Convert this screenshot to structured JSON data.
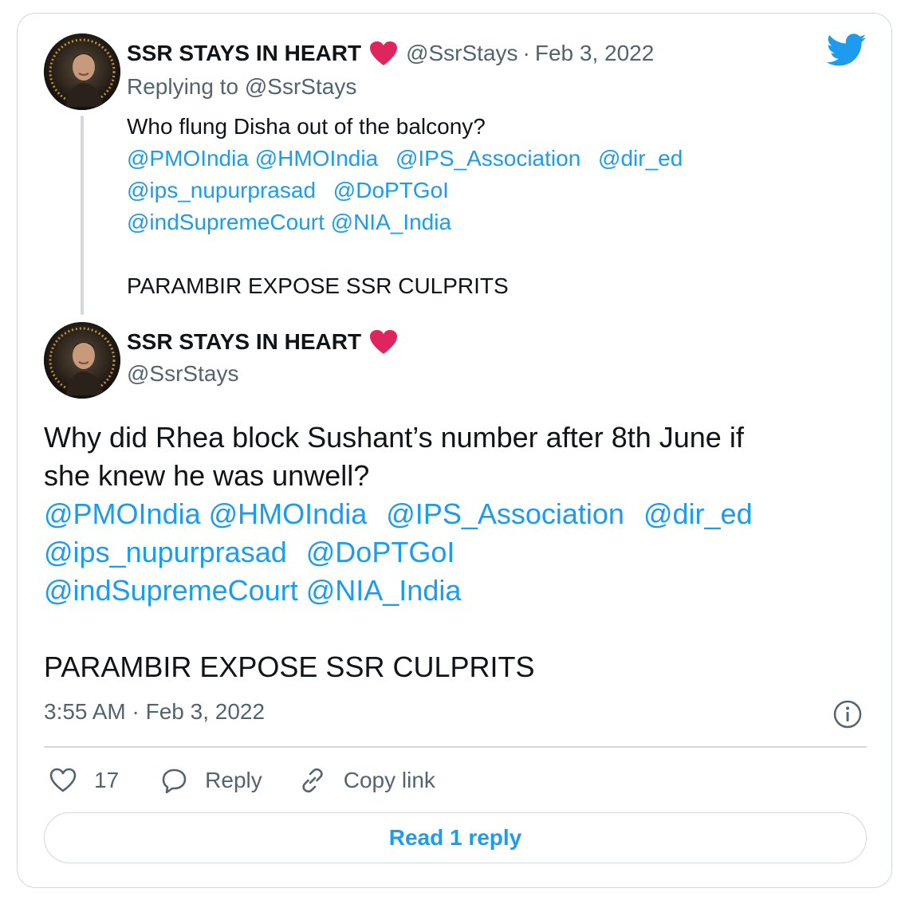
{
  "parent_tweet": {
    "display_name": "SSR STAYS IN HEART",
    "handle": "@SsrStays",
    "separator": "·",
    "date": "Feb 3, 2022",
    "replying_prefix": "Replying to",
    "replying_to": "@SsrStays",
    "text_line1": "Who flung Disha out of the balcony?",
    "mentions": {
      "pmo": "@PMOIndia",
      "hmo": "@HMOIndia",
      "ips": "@IPS_Association",
      "dir": "@dir_ed",
      "nupur": "@ips_nupurprasad",
      "dopt": "@DoPTGoI",
      "court": "@indSupremeCourt",
      "nia": "@NIA_India"
    },
    "text_last": "PARAMBIR EXPOSE SSR CULPRITS"
  },
  "main_tweet": {
    "display_name": "SSR STAYS IN HEART",
    "handle": "@SsrStays",
    "text_line1": "Why did Rhea block Sushant’s number after 8th June if",
    "text_line2": "she knew he was unwell?",
    "mentions": {
      "pmo": "@PMOIndia",
      "hmo": "@HMOIndia",
      "ips": "@IPS_Association",
      "dir": "@dir_ed",
      "nupur": "@ips_nupurprasad",
      "dopt": "@DoPTGoI",
      "court": "@indSupremeCourt",
      "nia": "@NIA_India"
    },
    "text_last": "PARAMBIR EXPOSE SSR CULPRITS",
    "time": "3:55 AM",
    "separator": "·",
    "date": "Feb 3, 2022"
  },
  "actions": {
    "like_count": "17",
    "reply_label": "Reply",
    "copy_label": "Copy link"
  },
  "read_replies_label": "Read 1 reply",
  "icons": {
    "heart_emoji": "red-heart-icon",
    "logo": "twitter-bird-icon",
    "info": "info-icon",
    "like": "heart-outline-icon",
    "reply": "speech-bubble-icon",
    "copy": "link-icon"
  },
  "colors": {
    "link": "#1d9bf0",
    "muted": "#536471",
    "text": "#0f1419",
    "border": "#cfd9de",
    "heart": "#e0245e"
  }
}
